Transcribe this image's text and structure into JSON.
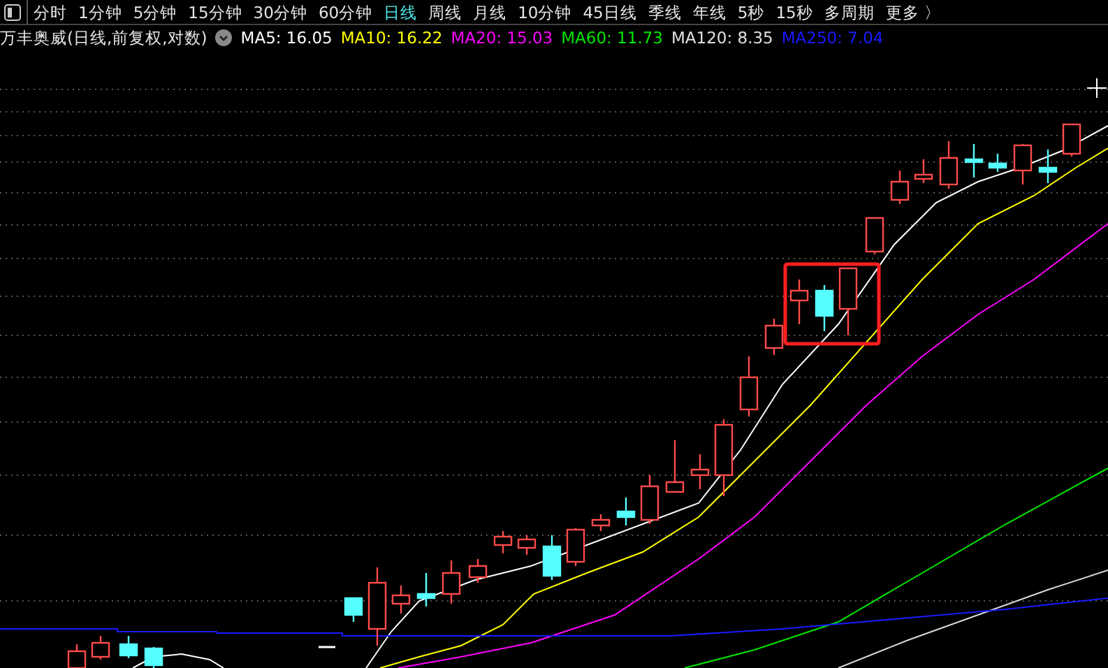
{
  "period_tabs": [
    {
      "label": "分时",
      "selected": false
    },
    {
      "label": "1分钟",
      "selected": false
    },
    {
      "label": "5分钟",
      "selected": false
    },
    {
      "label": "15分钟",
      "selected": false
    },
    {
      "label": "30分钟",
      "selected": false
    },
    {
      "label": "60分钟",
      "selected": false
    },
    {
      "label": "日线",
      "selected": true
    },
    {
      "label": "周线",
      "selected": false
    },
    {
      "label": "月线",
      "selected": false
    },
    {
      "label": "10分钟",
      "selected": false
    },
    {
      "label": "45日线",
      "selected": false
    },
    {
      "label": "季线",
      "selected": false
    },
    {
      "label": "年线",
      "selected": false
    },
    {
      "label": "5秒",
      "selected": false
    },
    {
      "label": "15秒",
      "selected": false
    },
    {
      "label": "多周期",
      "selected": false
    },
    {
      "label": "更多 〉",
      "selected": false
    }
  ],
  "chart_title": "万丰奥威(日线,前复权,对数)",
  "ma_legend": [
    {
      "text": "MA5: 16.05",
      "color": "#ffffff"
    },
    {
      "text": "MA10: 16.22",
      "color": "#ffff00"
    },
    {
      "text": "MA20: 15.03",
      "color": "#ff00ff"
    },
    {
      "text": "MA60: 11.73",
      "color": "#00e600"
    },
    {
      "text": "MA120: 8.35",
      "color": "#e0e0e0"
    },
    {
      "text": "MA250: 7.04",
      "color": "#1a1aff"
    }
  ]
}
